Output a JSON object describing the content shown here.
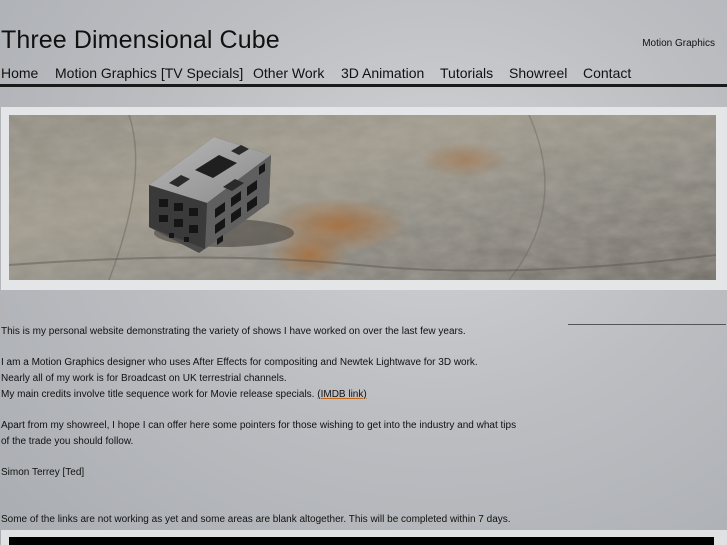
{
  "header": {
    "title": "Three Dimensional Cube",
    "tagline": "Motion Graphics"
  },
  "nav": {
    "items": [
      {
        "label": "Home"
      },
      {
        "label": "Motion Graphics [TV Specials]"
      },
      {
        "label": "Other Work"
      },
      {
        "label": "3D Animation"
      },
      {
        "label": "Tutorials"
      },
      {
        "label": "Showreel"
      },
      {
        "label": "Contact"
      }
    ]
  },
  "content": {
    "intro": "This is my personal website demonstrating the variety of shows I have worked on over the last few years.",
    "line1": "I am a Motion Graphics designer who uses After Effects for compositing and Newtek Lightwave for 3D work.",
    "line2": "Nearly all of my work is for Broadcast on UK terrestrial channels.",
    "line3": "My main credits involve title sequence work for Movie release specials.",
    "imdb_link": "(IMDB link)",
    "para3": "Apart from my showreel, I hope I can offer here some pointers for those wishing to get into the industry and what tips of the trade you should follow.",
    "signature": "Simon Terrey [Ted]",
    "notice": "Some of the links are not working as yet and some areas are blank altogether. This will be completed within 7 days."
  },
  "colors": {
    "background": "#bcbec2",
    "text": "#111111",
    "nav_rule": "#1a1a1a",
    "link_underline": "#c46a1e"
  }
}
